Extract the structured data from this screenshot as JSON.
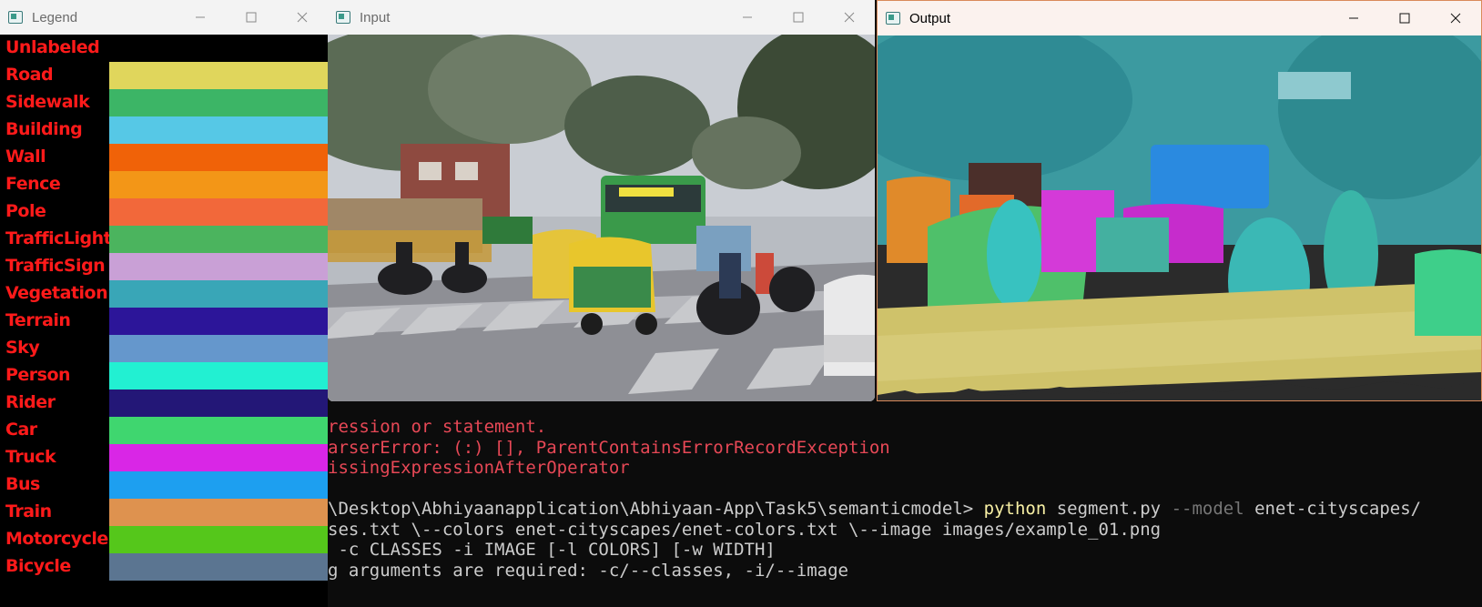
{
  "legend_window": {
    "title": "Legend",
    "classes": [
      {
        "label": "Unlabeled",
        "color": "#000000"
      },
      {
        "label": "Road",
        "color": "#e0d65c"
      },
      {
        "label": "Sidewalk",
        "color": "#3cb566"
      },
      {
        "label": "Building",
        "color": "#56c8e6"
      },
      {
        "label": "Wall",
        "color": "#f06208"
      },
      {
        "label": "Fence",
        "color": "#f39617"
      },
      {
        "label": "Pole",
        "color": "#f2683a"
      },
      {
        "label": "TrafficLight",
        "color": "#4bb45e"
      },
      {
        "label": "TrafficSign",
        "color": "#c9a0d6"
      },
      {
        "label": "Vegetation",
        "color": "#39a6b7"
      },
      {
        "label": "Terrain",
        "color": "#2c1599"
      },
      {
        "label": "Sky",
        "color": "#6597cc"
      },
      {
        "label": "Person",
        "color": "#22f0d2"
      },
      {
        "label": "Rider",
        "color": "#231777"
      },
      {
        "label": "Car",
        "color": "#3fd66f"
      },
      {
        "label": "Truck",
        "color": "#d926e6"
      },
      {
        "label": "Bus",
        "color": "#1d9ff0"
      },
      {
        "label": "Train",
        "color": "#de924f"
      },
      {
        "label": "Motorcycle",
        "color": "#55c71b"
      },
      {
        "label": "Bicycle",
        "color": "#5b7591"
      }
    ]
  },
  "input_window": {
    "title": "Input"
  },
  "output_window": {
    "title": "Output"
  },
  "window_controls": {
    "minimize": "minimize-icon",
    "maximize": "maximize-icon",
    "close": "close-icon"
  },
  "terminal": {
    "line1": "ression or statement.",
    "line2": "arserError: (:) [], ParentContainsErrorRecordException",
    "line3": "issingExpressionAfterOperator",
    "line5_path": "\\Desktop\\Abhiyaanapplication\\Abhiyaan-App\\Task5\\semanticmodel> ",
    "line5_cmd": "python",
    "line5_script": " segment.py ",
    "line5_flag": "--model",
    "line5_rest": " enet-cityscapes/",
    "line6": "ses.txt \\--colors enet-cityscapes/enet-colors.txt \\--image images/example_01.png",
    "line7": " -c CLASSES -i IMAGE [-l COLORS] [-w WIDTH]",
    "line8": "g arguments are required: -c/--classes, -i/--image"
  }
}
